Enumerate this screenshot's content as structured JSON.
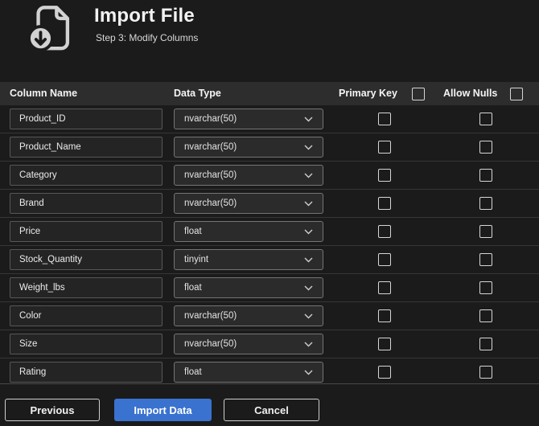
{
  "header": {
    "title": "Import File",
    "subtitle": "Step 3: Modify Columns",
    "icon": "import-file-icon"
  },
  "table": {
    "columns": {
      "name": "Column Name",
      "type": "Data Type",
      "primary_key": "Primary Key",
      "allow_nulls": "Allow Nulls"
    },
    "header_checkboxes": {
      "primary_key_all_checked": false,
      "allow_nulls_all_checked": false
    },
    "rows": [
      {
        "name": "Product_ID",
        "type": "nvarchar(50)",
        "primary_key": false,
        "allow_nulls": false
      },
      {
        "name": "Product_Name",
        "type": "nvarchar(50)",
        "primary_key": false,
        "allow_nulls": false
      },
      {
        "name": "Category",
        "type": "nvarchar(50)",
        "primary_key": false,
        "allow_nulls": false
      },
      {
        "name": "Brand",
        "type": "nvarchar(50)",
        "primary_key": false,
        "allow_nulls": false
      },
      {
        "name": "Price",
        "type": "float",
        "primary_key": false,
        "allow_nulls": false
      },
      {
        "name": "Stock_Quantity",
        "type": "tinyint",
        "primary_key": false,
        "allow_nulls": false
      },
      {
        "name": "Weight_lbs",
        "type": "float",
        "primary_key": false,
        "allow_nulls": false
      },
      {
        "name": "Color",
        "type": "nvarchar(50)",
        "primary_key": false,
        "allow_nulls": false
      },
      {
        "name": "Size",
        "type": "nvarchar(50)",
        "primary_key": false,
        "allow_nulls": false
      },
      {
        "name": "Rating",
        "type": "float",
        "primary_key": false,
        "allow_nulls": false
      }
    ]
  },
  "buttons": {
    "previous": "Previous",
    "import": "Import Data",
    "cancel": "Cancel"
  },
  "colors": {
    "background": "#1b1b1b",
    "table_header_band": "#2d2d2d",
    "accent_blue": "#3a72cf",
    "field_border": "#575757",
    "checkbox_border": "#d6d6d6",
    "icon_gray": "#d2d2d2"
  }
}
